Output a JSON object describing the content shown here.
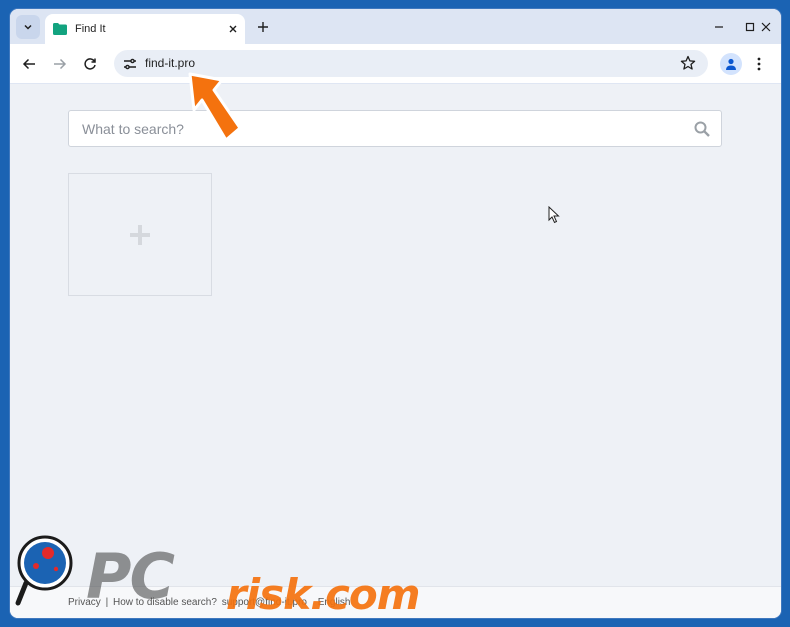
{
  "browser": {
    "tab": {
      "title": "Find It"
    },
    "address_bar": {
      "url": "find-it.pro"
    }
  },
  "page": {
    "search": {
      "placeholder": "What to search?"
    },
    "footer": {
      "privacy": "Privacy",
      "separator": "|",
      "disable": "How to disable search?",
      "support": "support@find-it.pro",
      "language": "English"
    }
  },
  "watermark": {
    "brand_pc": "PC",
    "brand_risk": "risk.com"
  },
  "colors": {
    "accent": "#0b57d0",
    "favicon": "#12a37f",
    "arrow": "#f4720e",
    "frame": "#1b63b3"
  },
  "icons": [
    "tab-search-icon",
    "folder-icon",
    "close-icon",
    "plus-icon",
    "minimize-icon",
    "maximize-icon",
    "back-icon",
    "forward-icon",
    "reload-icon",
    "tune-icon",
    "star-icon",
    "profile-icon",
    "menu-icon",
    "search-icon",
    "add-icon"
  ]
}
